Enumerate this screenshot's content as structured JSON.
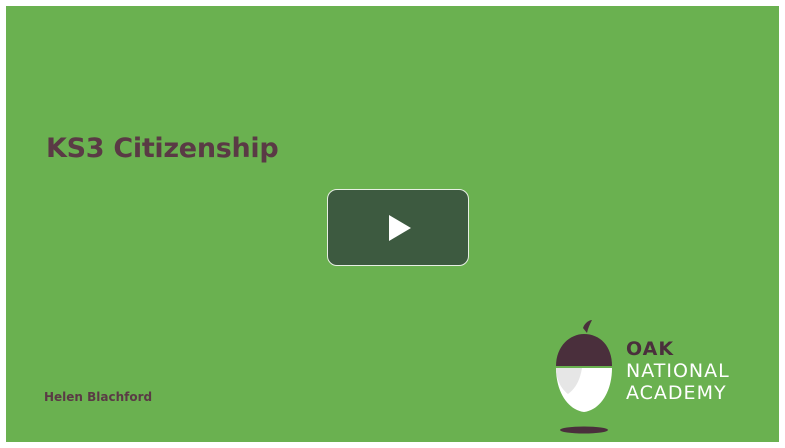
{
  "slide": {
    "title": "KS3 Citizenship",
    "presenter": "Helen Blachford",
    "background_color": "#6ab150"
  },
  "player": {
    "play_icon": "play-icon"
  },
  "logo": {
    "line1": "OAK",
    "line2": "NATIONAL",
    "line3": "ACADEMY",
    "icon": "acorn-icon"
  }
}
